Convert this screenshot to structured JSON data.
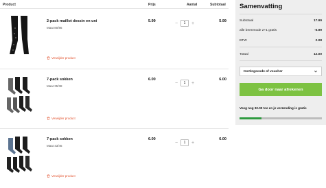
{
  "table": {
    "headers": {
      "product": "Product",
      "price": "Prijs",
      "quantity": "Aantal",
      "subtotal": "Subtotaal"
    }
  },
  "items": [
    {
      "name": "2-pack maillot dessin en uni",
      "size": "Maat 80/86",
      "price": "5.99",
      "quantity": "1",
      "subtotal": "5.99",
      "remove_label": "Verwijder product",
      "minus": "−",
      "plus": "+"
    },
    {
      "name": "7-pack sokken",
      "size": "Maat 35/38",
      "price": "6.00",
      "quantity": "1",
      "subtotal": "6.00",
      "remove_label": "Verwijder product",
      "minus": "−",
      "plus": "+"
    },
    {
      "name": "7-pack sokken",
      "size": "Maat 43/46",
      "price": "6.00",
      "quantity": "1",
      "subtotal": "6.00",
      "remove_label": "Verwijder product",
      "minus": "−",
      "plus": "+"
    }
  ],
  "summary": {
    "title": "Samenvatting",
    "rows": [
      {
        "label": "Subtotaal",
        "value": "17.99"
      },
      {
        "label": "alle beenmode 2+1 gratis",
        "value": "-5.99"
      },
      {
        "label": "BTW",
        "value": "2.08"
      },
      {
        "label": "Totaal",
        "value": "12.00"
      }
    ],
    "voucher_label": "Kortingscode of voucher",
    "checkout_label": "Ga door naar afrekenen",
    "shipping_note": "Voeg nog 32.00 toe en je verzending is gratis",
    "shipping_progress": 0.27
  },
  "colors": {
    "accent": "#7dc242",
    "progress": "#2e9a3f",
    "remove": "#e2512c"
  },
  "icons": {
    "remove": "trash-icon",
    "voucher": "chevron-down-icon"
  }
}
